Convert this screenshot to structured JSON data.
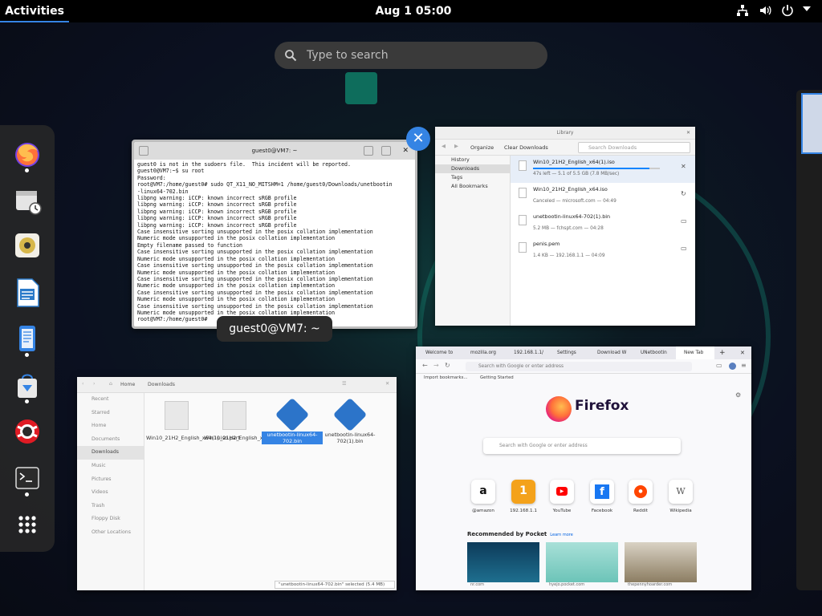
{
  "topbar": {
    "activities": "Activities",
    "clock": "Aug 1  05:00",
    "icons": [
      "network-icon",
      "volume-icon",
      "power-icon",
      "chevron-down-icon"
    ]
  },
  "search": {
    "placeholder": "Type to search"
  },
  "dash": {
    "apps": [
      {
        "name": "firefox",
        "running": true
      },
      {
        "name": "screenshot",
        "running": false
      },
      {
        "name": "rhythmbox",
        "running": false
      },
      {
        "name": "libreoffice-writer",
        "running": false
      },
      {
        "name": "text-editor",
        "running": true
      },
      {
        "name": "software",
        "running": true
      },
      {
        "name": "help",
        "running": false
      },
      {
        "name": "terminal",
        "running": true
      },
      {
        "name": "show-apps",
        "running": false
      }
    ]
  },
  "terminal": {
    "title": "guest0@VM7: ~",
    "label": "guest0@VM7: ~",
    "close": "✕",
    "lines": [
      "guest0 is not in the sudoers file.  This incident will be reported.",
      "guest0@VM7:~$ su root",
      "Password:",
      "root@VM7:/home/guest0# sudo QT_X11_NO_MITSHM=1 /home/guest0/Downloads/unetbootin",
      "-linux64-702.bin",
      "libpng warning: iCCP: known incorrect sRGB profile",
      "libpng warning: iCCP: known incorrect sRGB profile",
      "libpng warning: iCCP: known incorrect sRGB profile",
      "libpng warning: iCCP: known incorrect sRGB profile",
      "libpng warning: iCCP: known incorrect sRGB profile",
      "Case insensitive sorting unsupported in the posix collation implementation",
      "Numeric mode unsupported in the posix collation implementation",
      "Empty filename passed to function",
      "Case insensitive sorting unsupported in the posix collation implementation",
      "Numeric mode unsupported in the posix collation implementation",
      "Case insensitive sorting unsupported in the posix collation implementation",
      "Numeric mode unsupported in the posix collation implementation",
      "Case insensitive sorting unsupported in the posix collation implementation",
      "Numeric mode unsupported in the posix collation implementation",
      "Case insensitive sorting unsupported in the posix collation implementation",
      "Numeric mode unsupported in the posix collation implementation",
      "Case insensitive sorting unsupported in the posix collation implementation",
      "Numeric mode unsupported in the posix collation implementation",
      "root@VM7:/home/guest0# "
    ]
  },
  "library": {
    "title": "Library",
    "organize": "Organize",
    "clear": "Clear Downloads",
    "search_placeholder": "Search Downloads",
    "sidebar": [
      "History",
      "Downloads",
      "Tags",
      "All Bookmarks"
    ],
    "downloads": [
      {
        "name": "Win10_21H2_English_x64(1).iso",
        "status": "47s left — 5.1 of 5.5 GB (7.8 MB/sec)",
        "progress": 0.92,
        "action": "✕"
      },
      {
        "name": "Win10_21H2_English_x64.iso",
        "status": "Canceled — microsoft.com — 04:49",
        "action": "↻"
      },
      {
        "name": "unetbootin-linux64-702(1).bin",
        "status": "5.2 MB — fchspt.com — 04:28",
        "action": "▭"
      },
      {
        "name": "penis.pem",
        "status": "1.4 KB — 192.168.1.1 — 04:09",
        "action": "▭"
      }
    ]
  },
  "files": {
    "path": [
      "Home",
      "Downloads"
    ],
    "sidebar": [
      "Recent",
      "Starred",
      "Home",
      "Documents",
      "Downloads",
      "Music",
      "Pictures",
      "Videos",
      "Trash",
      "Floppy Disk",
      "Other Locations"
    ],
    "items": [
      {
        "label": "Win10_21H2_English_x64(1).iso.part",
        "kind": "doc",
        "selected": false
      },
      {
        "label": "Win10_21H2_English_x64.iso",
        "kind": "doc",
        "selected": false
      },
      {
        "label": "unetbootin-linux64-702.bin",
        "kind": "bin",
        "selected": true
      },
      {
        "label": "unetbootin-linux64-702(1).bin",
        "kind": "bin",
        "selected": false
      }
    ],
    "status": "\"unetbootin-linux64-702.bin\" selected (5.4 MB)"
  },
  "firefox": {
    "tabs": [
      "Welcome to",
      "mozilla.org",
      "192.168.1.1/",
      "Settings",
      "Download W",
      "UNetbootin",
      "New Tab"
    ],
    "url_placeholder": "Search with Google or enter address",
    "bookmarks": [
      "Import bookmarks...",
      "Getting Started"
    ],
    "brand": "Firefox",
    "search_placeholder": "Search with Google or enter address",
    "sites": [
      {
        "label": "@amazon",
        "glyph": "a"
      },
      {
        "label": "192.168.1.1",
        "glyph": "1"
      },
      {
        "label": "YouTube",
        "glyph": "▶"
      },
      {
        "label": "Facebook",
        "glyph": "f"
      },
      {
        "label": "Reddit",
        "glyph": "●"
      },
      {
        "label": "Wikipedia",
        "glyph": "W"
      }
    ],
    "pocket_title": "Recommended by Pocket",
    "pocket_link": "Learn more",
    "cards": [
      "nr.com",
      "hyejo.pocket.com",
      "thepennyhoarder.com"
    ]
  },
  "colors": {
    "accent": "#3584e4",
    "topbar": "#000000",
    "dash": "#282828"
  }
}
